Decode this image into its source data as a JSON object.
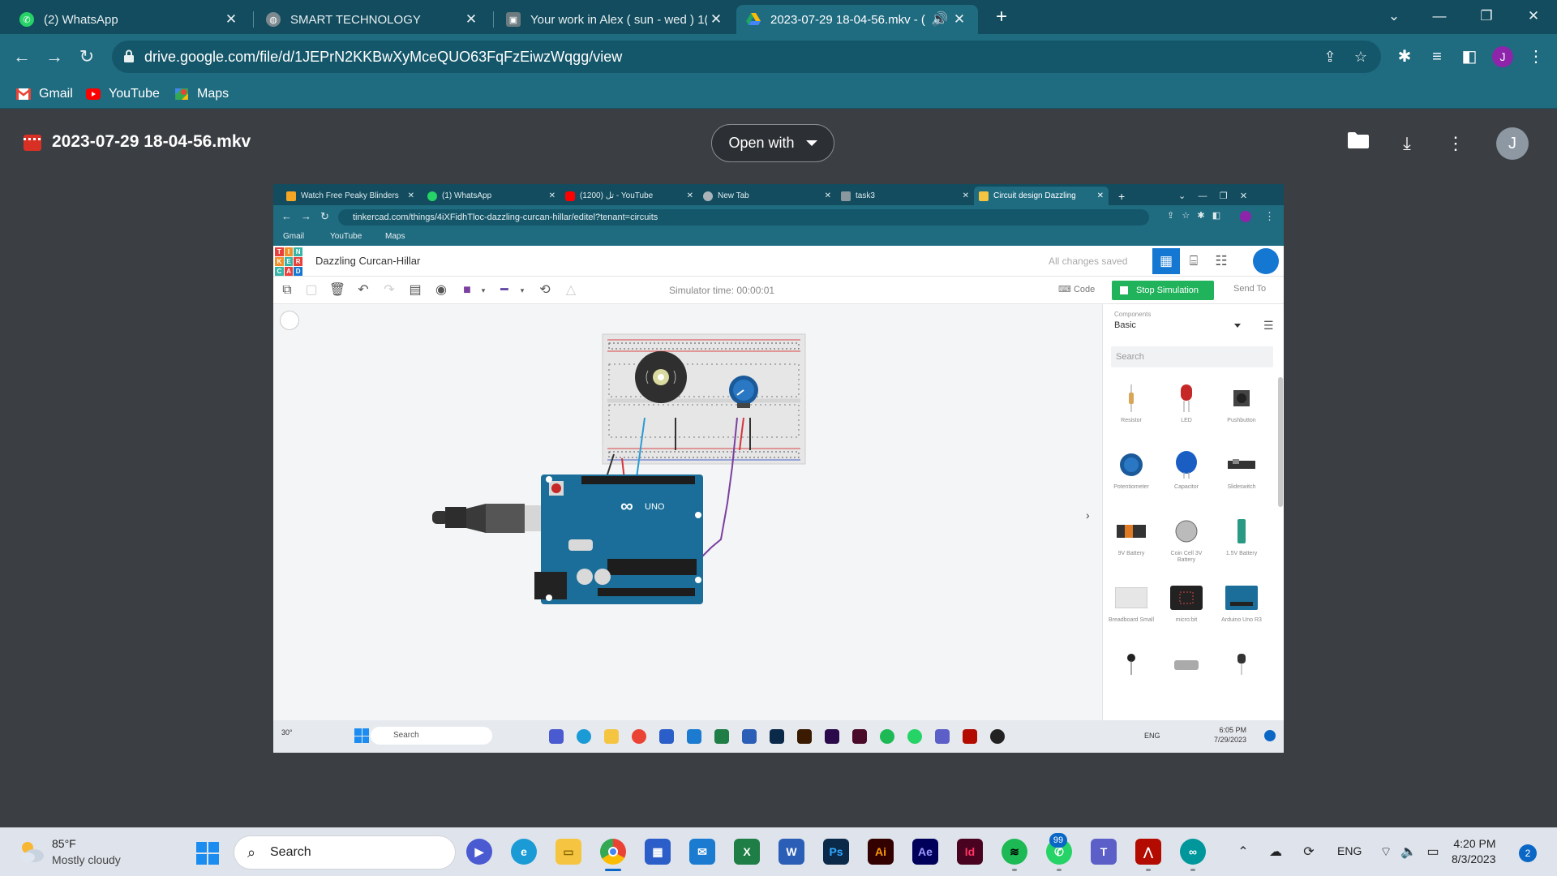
{
  "browser": {
    "tabs": [
      {
        "title": "(2) WhatsApp",
        "icon": "whatsapp-icon"
      },
      {
        "title": "SMART TECHNOLOGY",
        "icon": "globe-icon"
      },
      {
        "title": "Your work in Alex ( sun - wed ) 1(",
        "icon": "classroom-icon"
      },
      {
        "title": "2023-07-29 18-04-56.mkv - (",
        "icon": "google-drive-icon",
        "active": true
      }
    ],
    "address": "drive.google.com/file/d/1JEPrN2KKBwXyMceQUO63FqFzEiwzWqgg/view",
    "profile_initial": "J",
    "bookmarks": [
      {
        "label": "Gmail",
        "icon": "gmail-icon"
      },
      {
        "label": "YouTube",
        "icon": "youtube-icon"
      },
      {
        "label": "Maps",
        "icon": "maps-icon"
      }
    ]
  },
  "drive": {
    "file_title": "2023-07-29 18-04-56.mkv",
    "open_with": "Open with",
    "avatar_initial": "J"
  },
  "video": {
    "tabs": [
      "Watch Free Peaky Blinders",
      "(1) WhatsApp",
      "(1200) تل - YouTube",
      "New Tab",
      "task3",
      "Circuit design Dazzling"
    ],
    "address": "tinkercad.com/things/4iXFidhTloc-dazzling-curcan-hillar/editel?tenant=circuits",
    "bookmarks": [
      "Gmail",
      "YouTube",
      "Maps"
    ],
    "logo_letters": [
      "T",
      "I",
      "N",
      "K",
      "E",
      "R",
      "C",
      "A",
      "D"
    ],
    "design_name": "Dazzling Curcan-Hillar",
    "saved_status": "All changes saved",
    "sim_time": "Simulator time: 00:00:01",
    "code_label": "Code",
    "stop_label": "Stop Simulation",
    "send_label": "Send To",
    "components_label": "Components",
    "components_value": "Basic",
    "search_placeholder": "Search",
    "components": [
      "Resistor",
      "LED",
      "Pushbutton",
      "Potentiometer",
      "Capacitor",
      "Slideswitch",
      "9V Battery",
      "Coin Cell 3V Battery",
      "1.5V Battery",
      "Breadboard Small",
      "micro:bit",
      "Arduino Uno R3"
    ],
    "taskbar_search": "Search",
    "lang": "ENG",
    "clock_time": "6:05 PM",
    "clock_date": "7/29/2023",
    "temp": "30°"
  },
  "taskbar": {
    "weather_temp": "85°F",
    "weather_cond": "Mostly cloudy",
    "search": "Search",
    "lang": "ENG",
    "time": "4:20 PM",
    "date": "8/3/2023",
    "notifications": "2",
    "whatsapp_badge": "99",
    "apps": [
      "meet-icon",
      "edge-icon",
      "file-explorer-icon",
      "chrome-icon",
      "store-icon",
      "mail-icon",
      "excel-icon",
      "word-icon",
      "photoshop-icon",
      "illustrator-icon",
      "after-effects-icon",
      "indesign-icon",
      "spotify-icon",
      "whatsapp-icon",
      "teams-icon",
      "acrobat-icon",
      "arduino-icon"
    ]
  },
  "colors": {
    "chrome_frame": "#124c5e",
    "chrome_toolbar": "#1f6b80",
    "viewer_bg": "#3b3e42",
    "tinkercad_blue": "#1477d1",
    "stop_green": "#21b35b",
    "arduino_blue": "#1a6e99"
  }
}
